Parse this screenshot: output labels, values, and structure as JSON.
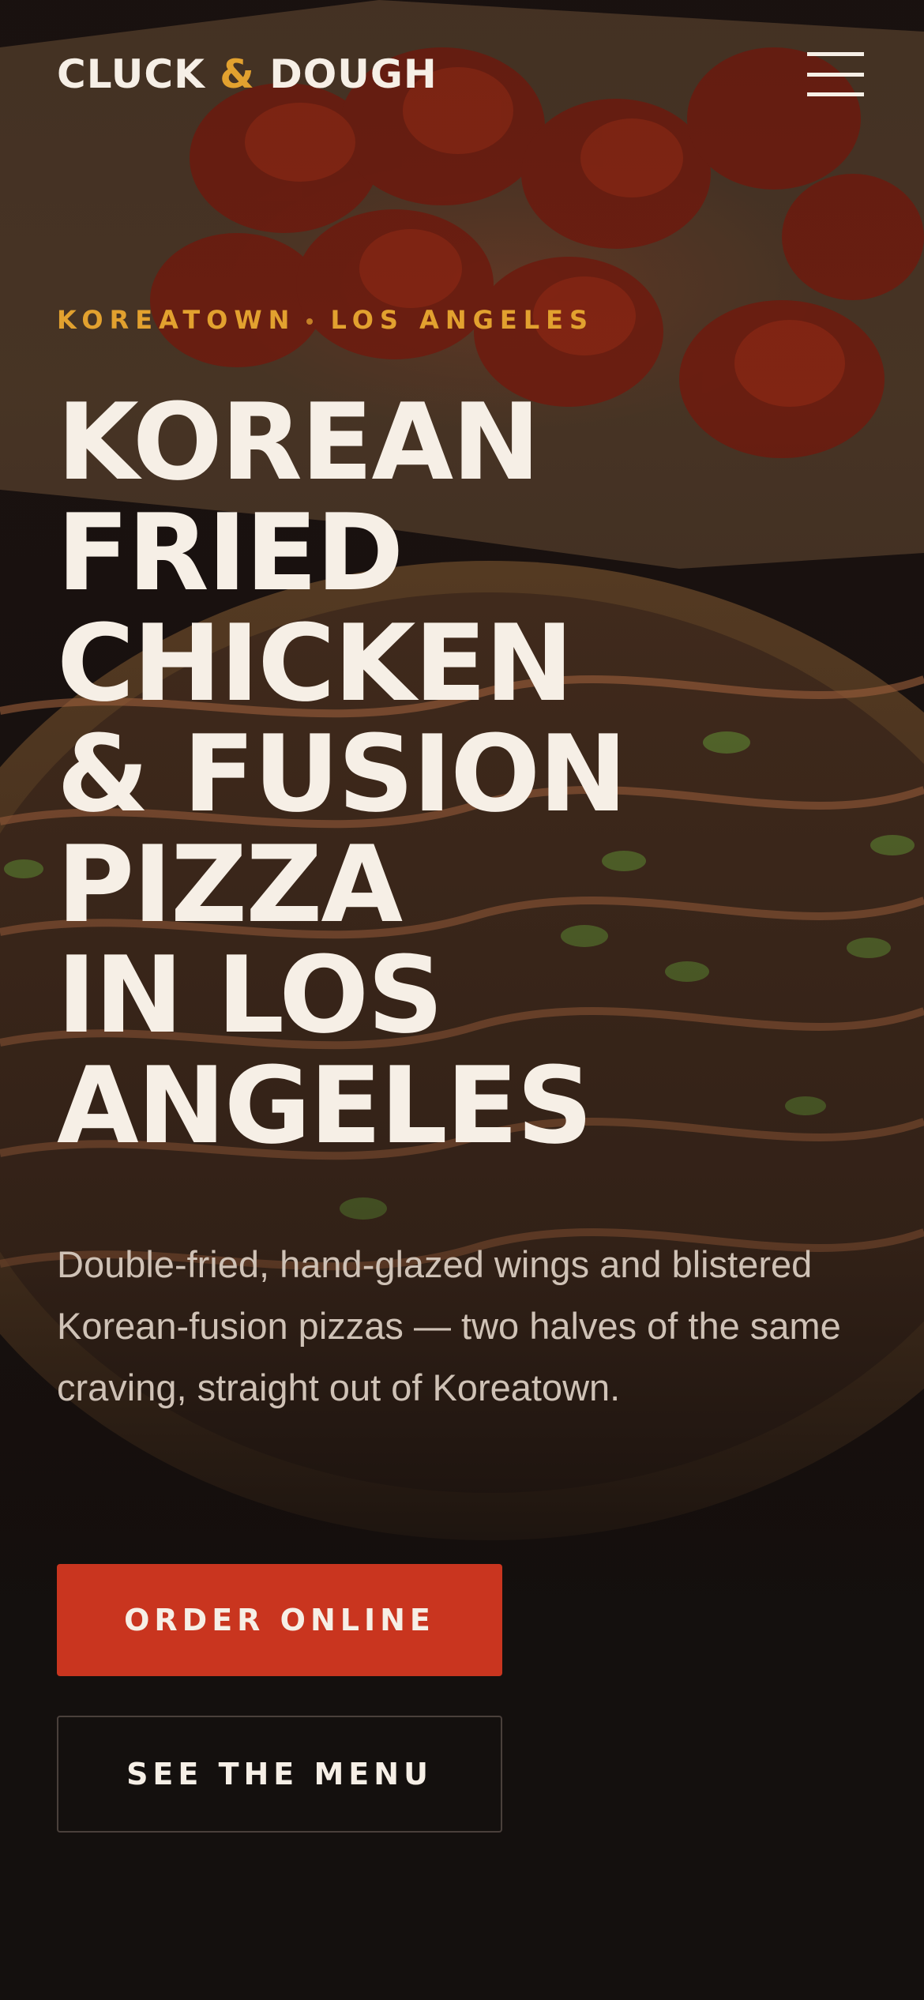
{
  "header": {
    "logo_part1": "CLUCK ",
    "logo_amp": "&",
    "logo_part2": " DOUGH",
    "menu_icon": "hamburger-menu-icon"
  },
  "hero": {
    "eyebrow_left": "KOREATOWN",
    "eyebrow_right": "LOS ANGELES",
    "headline_lines": [
      "Korean",
      "Fried",
      "Chicken",
      "& Fusion",
      "Pizza",
      "in Los",
      "Angeles"
    ],
    "subtitle": "Double-fried, hand-glazed wings and blistered Korean-fusion pizzas — two halves of the same craving, straight out of Koreatown.",
    "primary_cta": "ORDER ONLINE",
    "secondary_cta": "SEE THE MENU"
  },
  "colors": {
    "background": "#141010",
    "accent": "#e2a12f",
    "cta": "#c9351f",
    "text": "#f6efe6",
    "muted_text": "#cfc2b6"
  }
}
